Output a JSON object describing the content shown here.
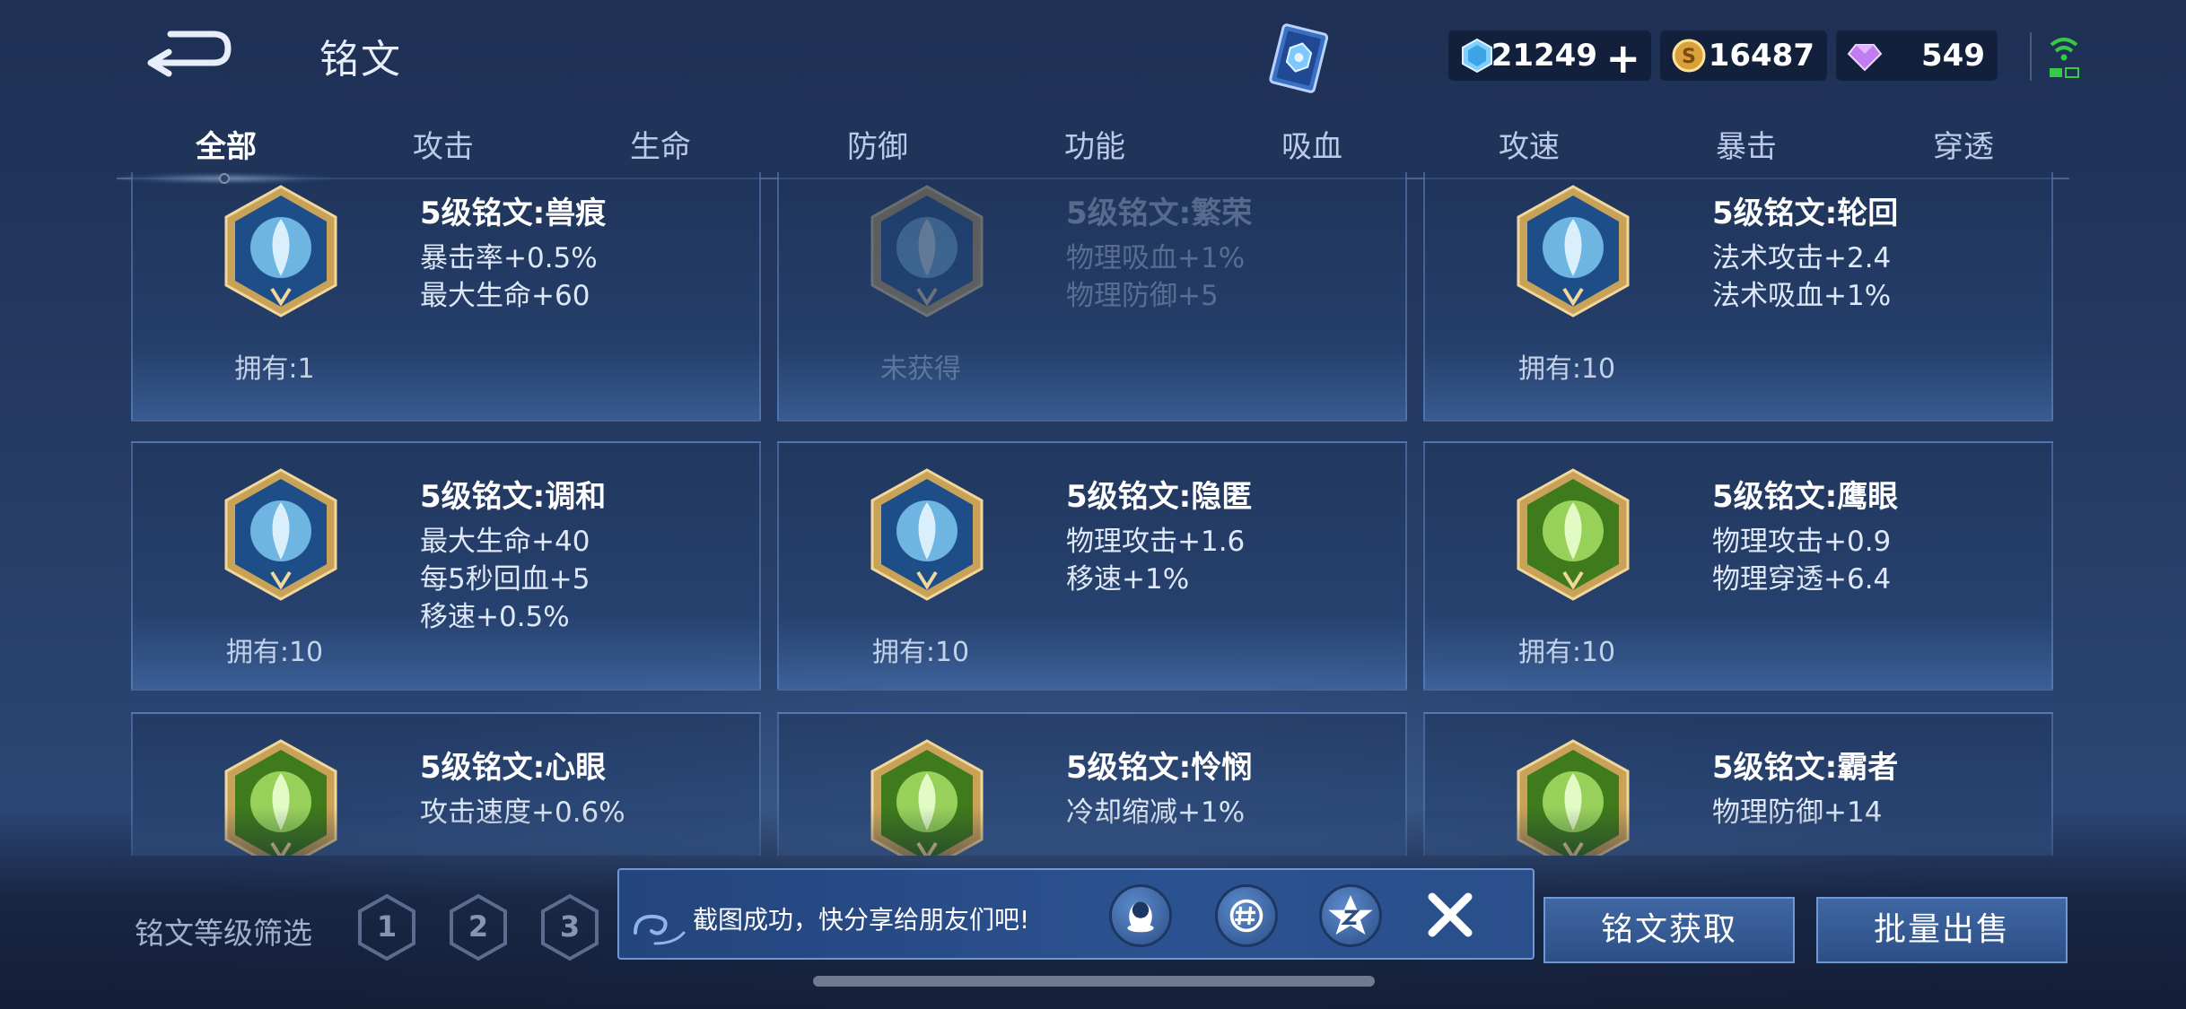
{
  "header": {
    "title": "铭文",
    "currencies": [
      {
        "icon": "diamond-icon",
        "value": "21249",
        "has_plus": true
      },
      {
        "icon": "gold-coin-icon",
        "value": "16487"
      },
      {
        "icon": "purple-gem-icon",
        "value": "549"
      }
    ]
  },
  "tabs": [
    {
      "label": "全部",
      "active": true
    },
    {
      "label": "攻击"
    },
    {
      "label": "生命"
    },
    {
      "label": "防御"
    },
    {
      "label": "功能"
    },
    {
      "label": "吸血"
    },
    {
      "label": "攻速"
    },
    {
      "label": "暴击"
    },
    {
      "label": "穿透"
    }
  ],
  "runes": [
    {
      "name": "5级铭文:兽痕",
      "stats": [
        "暴击率+0.5%",
        "最大生命+60"
      ],
      "owned": "拥有:1",
      "color": "blue",
      "dim": false
    },
    {
      "name": "5级铭文:繁荣",
      "stats": [
        "物理吸血+1%",
        "物理防御+5"
      ],
      "owned": "未获得",
      "color": "blue",
      "dim": true
    },
    {
      "name": "5级铭文:轮回",
      "stats": [
        "法术攻击+2.4",
        "法术吸血+1%"
      ],
      "owned": "拥有:10",
      "color": "blue",
      "dim": false
    },
    {
      "name": "5级铭文:调和",
      "stats": [
        "最大生命+40",
        "每5秒回血+5",
        "移速+0.5%"
      ],
      "owned": "拥有:10",
      "color": "blue",
      "dim": false
    },
    {
      "name": "5级铭文:隐匿",
      "stats": [
        "物理攻击+1.6",
        "移速+1%"
      ],
      "owned": "拥有:10",
      "color": "blue",
      "dim": false
    },
    {
      "name": "5级铭文:鹰眼",
      "stats": [
        "物理攻击+0.9",
        "物理穿透+6.4"
      ],
      "owned": "拥有:10",
      "color": "green",
      "dim": false
    },
    {
      "name": "5级铭文:心眼",
      "stats": [
        "攻击速度+0.6%"
      ],
      "owned": "",
      "color": "green",
      "dim": false
    },
    {
      "name": "5级铭文:怜悯",
      "stats": [
        "冷却缩减+1%"
      ],
      "owned": "",
      "color": "green",
      "dim": false
    },
    {
      "name": "5级铭文:霸者",
      "stats": [
        "物理防御+14"
      ],
      "owned": "",
      "color": "green",
      "dim": false
    }
  ],
  "bottom": {
    "filter_label": "铭文等级筛选",
    "levels": [
      "1",
      "2",
      "3"
    ],
    "acquire_label": "铭文获取",
    "sell_label": "批量出售"
  },
  "toast": {
    "message": "截图成功，快分享给朋友们吧!",
    "share_icons": [
      "qq-icon",
      "wechat-moments-icon",
      "qzone-icon"
    ]
  }
}
